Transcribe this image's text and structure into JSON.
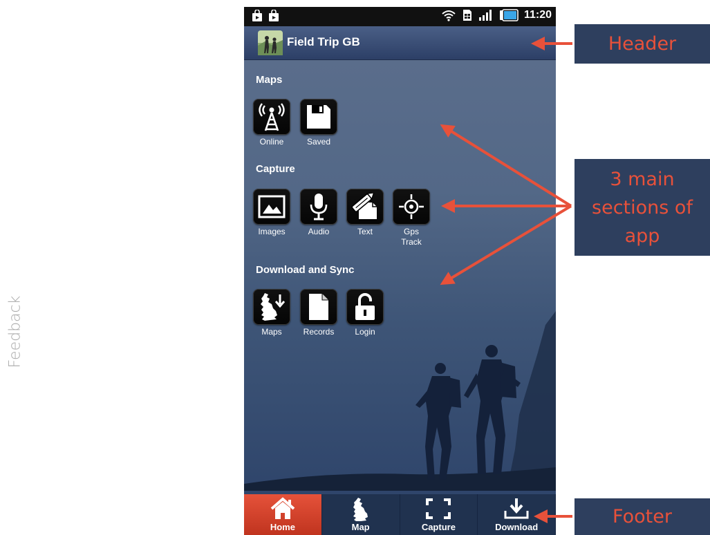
{
  "side_label": "Feedback",
  "status_bar": {
    "time": "11:20",
    "left_icons": [
      "shopping-bag-icon",
      "shopping-bag-icon"
    ],
    "right_icons": [
      "wifi-icon",
      "sim-card-icon",
      "signal-bars-icon",
      "battery-icon"
    ]
  },
  "header": {
    "title": "Field Trip GB",
    "logo": "hikers-logo"
  },
  "sections": [
    {
      "heading": "Maps",
      "tiles": [
        {
          "label": "Online",
          "icon": "radio-tower-icon"
        },
        {
          "label": "Saved",
          "icon": "floppy-disk-icon"
        }
      ]
    },
    {
      "heading": "Capture",
      "tiles": [
        {
          "label": "Images",
          "icon": "image-icon"
        },
        {
          "label": "Audio",
          "icon": "microphone-icon"
        },
        {
          "label": "Text",
          "icon": "pencil-note-icon"
        },
        {
          "label": "Gps Track",
          "label_line1": "Gps",
          "label_line2": "Track",
          "icon": "gps-crosshair-icon"
        }
      ]
    },
    {
      "heading": "Download and Sync",
      "tiles": [
        {
          "label": "Maps",
          "icon": "gb-map-download-icon"
        },
        {
          "label": "Records",
          "icon": "document-icon"
        },
        {
          "label": "Login",
          "icon": "padlock-open-icon"
        }
      ]
    }
  ],
  "footer": {
    "tabs": [
      {
        "label": "Home",
        "icon": "home-icon",
        "active": true
      },
      {
        "label": "Map",
        "icon": "gb-map-icon",
        "active": false
      },
      {
        "label": "Capture",
        "icon": "capture-frame-icon",
        "active": false
      },
      {
        "label": "Download",
        "icon": "download-tray-icon",
        "active": false
      }
    ]
  },
  "annotations": {
    "header": "Header",
    "sections_line1": "3 main",
    "sections_line2": "sections of",
    "sections_line3": "app",
    "footer": "Footer"
  },
  "colors": {
    "callout_background": "#2e3f5e",
    "callout_text": "#e8513a",
    "arrow": "#e8513a",
    "active_tab": "#d8442d",
    "header_bar": "#34486f"
  }
}
